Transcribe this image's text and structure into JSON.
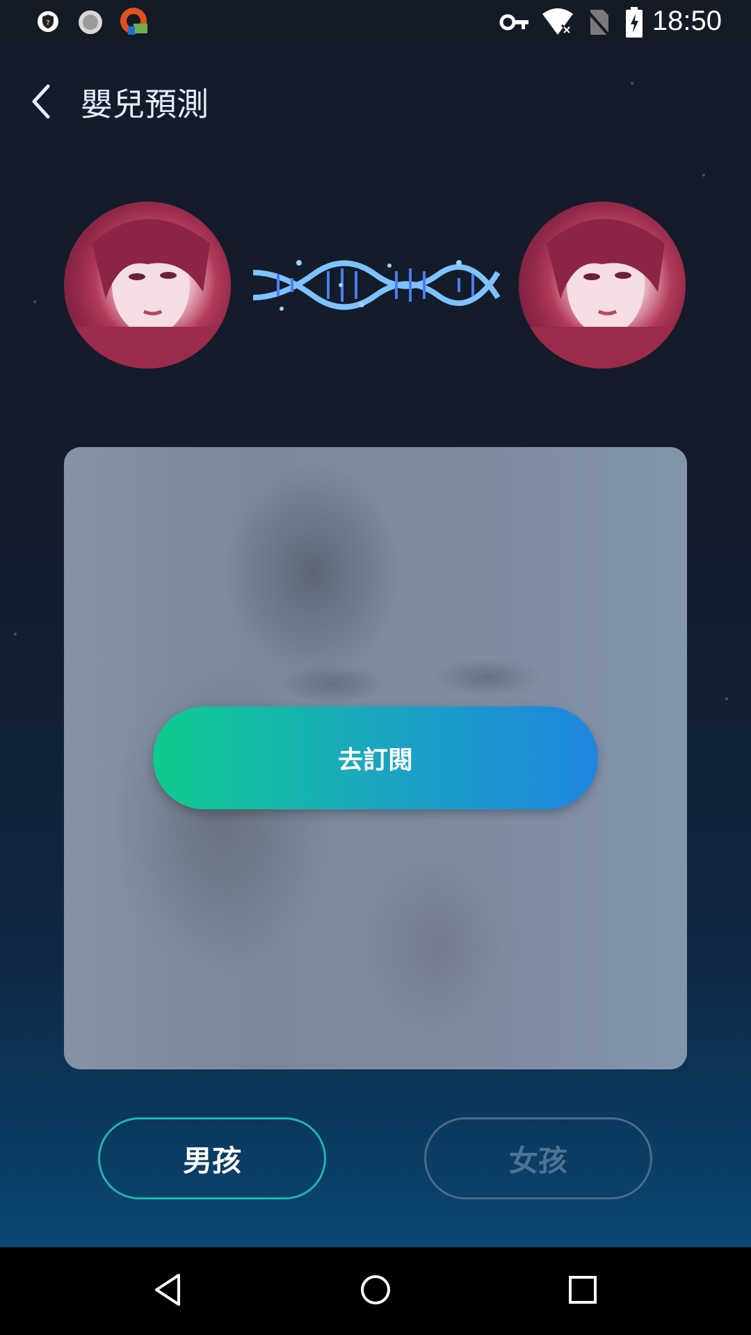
{
  "status_bar": {
    "time": "18:50",
    "icons": [
      "shield-icon",
      "sync-icon",
      "app-icon",
      "key-icon",
      "wifi-icon",
      "no-sim-icon",
      "battery-charging-icon"
    ]
  },
  "header": {
    "title": "嬰兒預測",
    "back_icon": "back-arrow-icon"
  },
  "preview": {
    "subscribe_label": "去訂閱"
  },
  "gender": {
    "boy_label": "男孩",
    "girl_label": "女孩",
    "selected": "男孩"
  },
  "colors": {
    "accent_green": "#0ecb8d",
    "accent_blue": "#1f85e0",
    "background_top": "#151b29",
    "background_bottom": "#0b4670"
  },
  "nav_bar": {
    "icons": [
      "nav-back-icon",
      "nav-home-icon",
      "nav-recents-icon"
    ]
  }
}
